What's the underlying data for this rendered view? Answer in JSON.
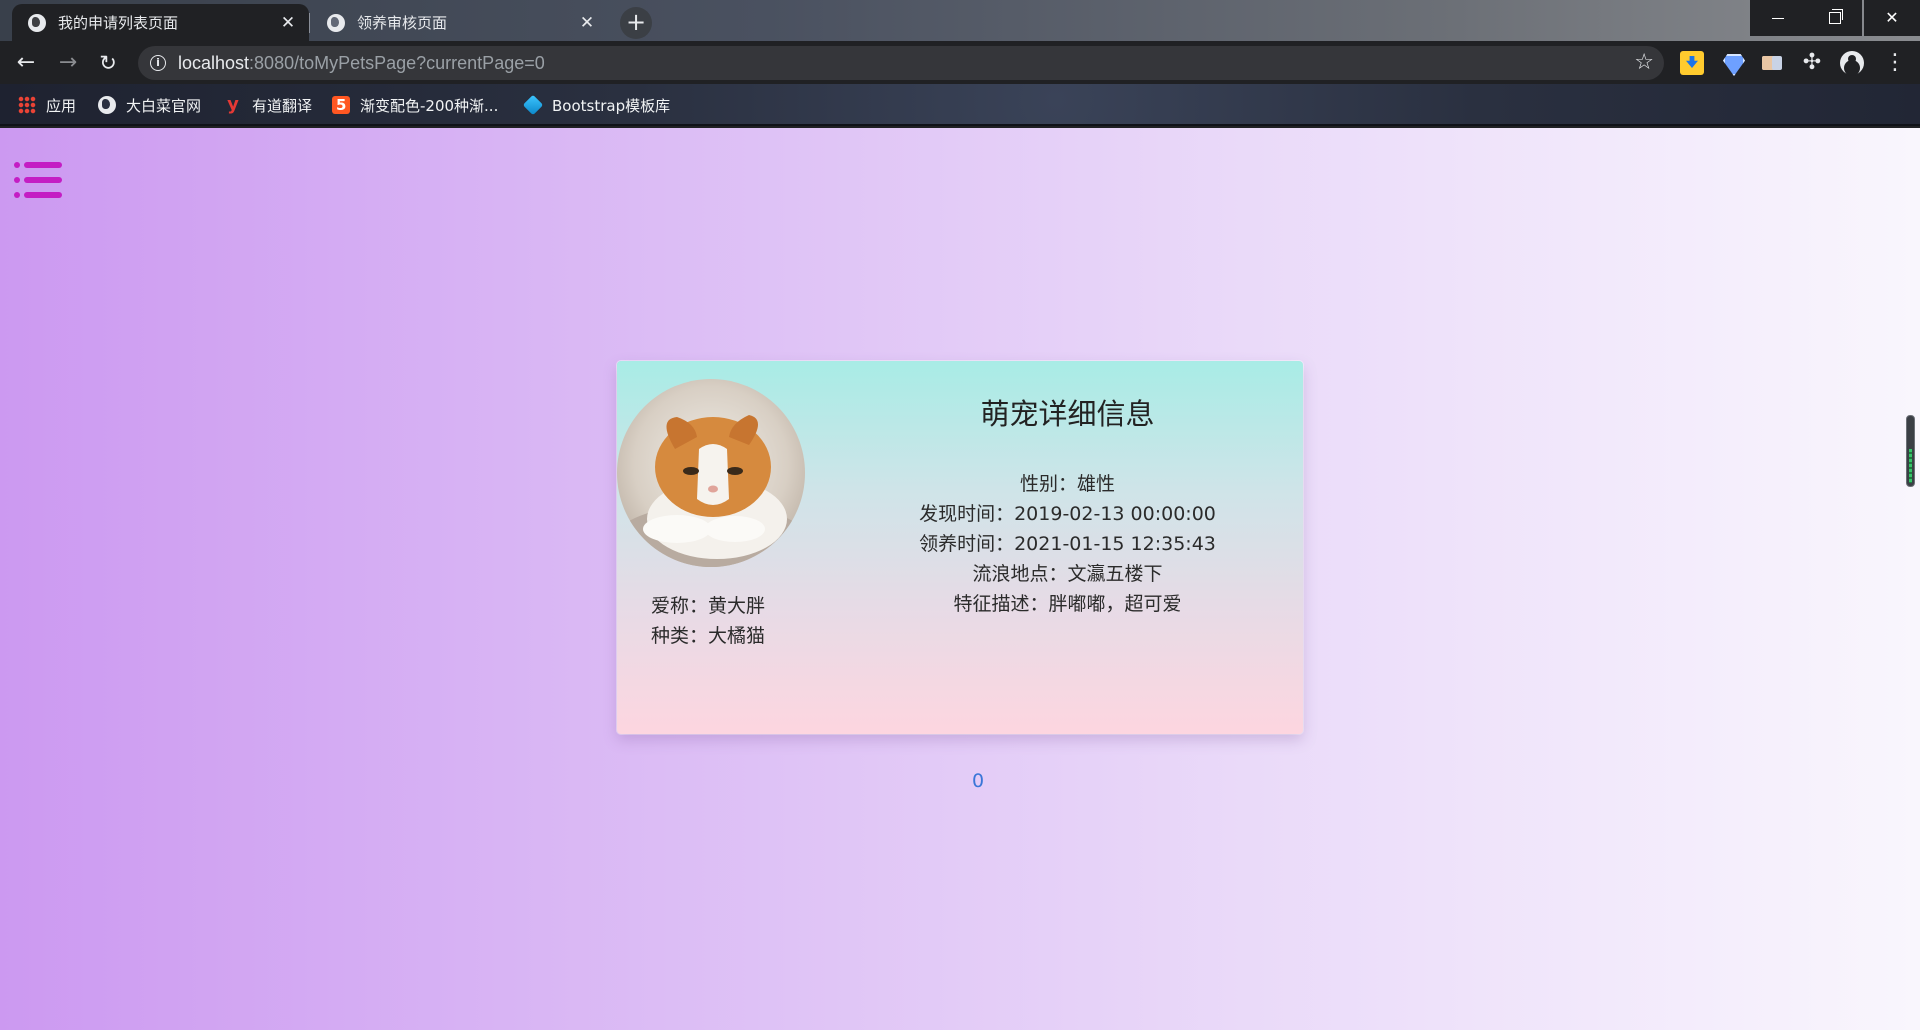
{
  "browser": {
    "tabs": [
      {
        "title": "我的申请列表页面",
        "active": true
      },
      {
        "title": "领养审核页面",
        "active": false
      }
    ],
    "url_host": "localhost",
    "url_rest": ":8080/toMyPetsPage?currentPage=0",
    "bookmarks": [
      {
        "label": "应用",
        "icon": "apps-grid-icon"
      },
      {
        "label": "大白菜官网",
        "icon": "globe-icon"
      },
      {
        "label": "有道翻译",
        "icon": "youdao-icon"
      },
      {
        "label": "渐变配色-200种渐...",
        "icon": "html5-icon"
      },
      {
        "label": "Bootstrap模板库",
        "icon": "cube-icon"
      }
    ]
  },
  "page": {
    "card": {
      "title": "萌宠详细信息",
      "nickname": "爱称：黄大胖",
      "species": "种类：大橘猫",
      "gender": "性别：雄性",
      "found_time": "发现时间：2019-02-13 00:00:00",
      "adopt_time": "领养时间：2021-01-15 12:35:43",
      "location": "流浪地点：文瀛五楼下",
      "description": "特征描述：胖嘟嘟，超可爱"
    },
    "pager": {
      "current": "0"
    }
  },
  "colors": {
    "page_gradient": [
      "#cc99f1",
      "#f9f6fd"
    ],
    "menu_icon": "#c41dc4",
    "pager_link": "#3a76d8"
  }
}
